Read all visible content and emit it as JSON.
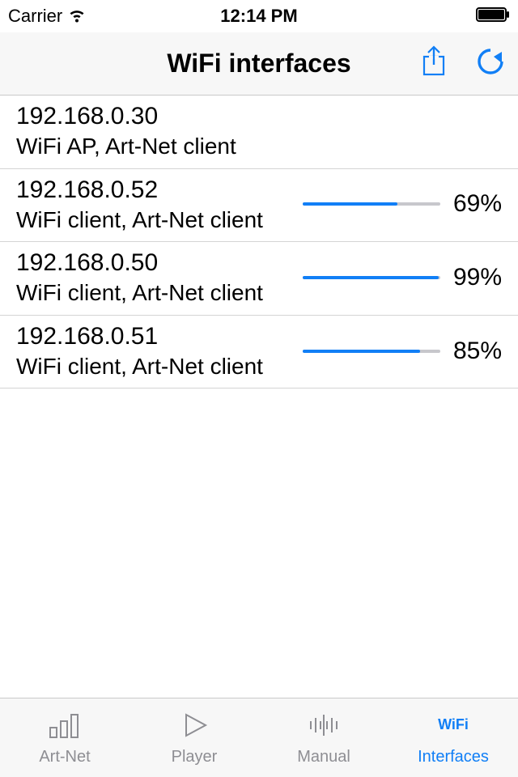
{
  "status_bar": {
    "carrier": "Carrier",
    "time": "12:14 PM"
  },
  "nav": {
    "title": "WiFi interfaces"
  },
  "rows": [
    {
      "ip": "192.168.0.30",
      "desc": "WiFi AP, Art-Net client",
      "progress": null,
      "percent_label": ""
    },
    {
      "ip": "192.168.0.52",
      "desc": "WiFi client, Art-Net client",
      "progress": 69,
      "percent_label": "69%"
    },
    {
      "ip": "192.168.0.50",
      "desc": "WiFi client, Art-Net client",
      "progress": 99,
      "percent_label": "99%"
    },
    {
      "ip": "192.168.0.51",
      "desc": "WiFi client, Art-Net client",
      "progress": 85,
      "percent_label": "85%"
    }
  ],
  "tabs": [
    {
      "id": "artnet",
      "label": "Art-Net",
      "active": false
    },
    {
      "id": "player",
      "label": "Player",
      "active": false
    },
    {
      "id": "manual",
      "label": "Manual",
      "active": false
    },
    {
      "id": "interfaces",
      "label": "Interfaces",
      "active": true
    }
  ],
  "colors": {
    "tint": "#117ff6",
    "gray": "#8e8e93",
    "separator": "#d4d4d4",
    "bar_bg": "#f7f7f7"
  }
}
